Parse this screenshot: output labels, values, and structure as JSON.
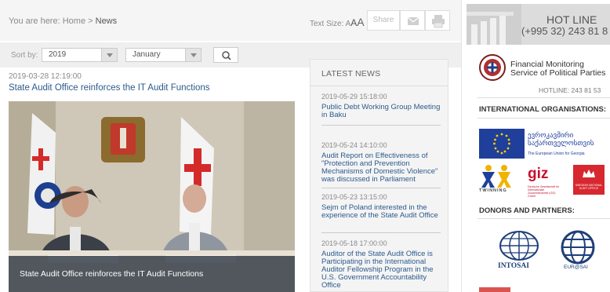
{
  "breadcrumb": {
    "prefix": "You are here:",
    "home": "Home",
    "separator": ">",
    "current": "News"
  },
  "text_size": {
    "label": "Text Size:",
    "small": "A",
    "medium": "A",
    "large": "A"
  },
  "toolbar": {
    "share_label": "Share",
    "mail_icon": "mail-icon",
    "print_icon": "print-icon"
  },
  "filter": {
    "sort_label": "Sort by:",
    "year_value": "2019",
    "month_value": "January",
    "search_icon": "search-icon"
  },
  "article": {
    "date": "2019-03-28 12:19:00",
    "title": "State Audit Office reinforces the IT Audit Functions",
    "caption": "State Audit Office reinforces the IT Audit Functions"
  },
  "latest_news": {
    "heading": "LATEST NEWS",
    "items": [
      {
        "date": "2019-05-29 15:18:00",
        "title": "Public Debt Working Group Meeting in Baku"
      },
      {
        "date": "2019-05-24 14:10:00",
        "title": "Audit Report on Effectiveness of \"Protection and Prevention Mechanisms of Domestic Violence\" was discussed in Parliament"
      },
      {
        "date": "2019-05-23 13:15:00",
        "title": "Sejm of Poland interested in the experience of the State Audit Office"
      },
      {
        "date": "2019-05-18 17:00:00",
        "title": "Auditor of the State Audit Office is Participating in the International Auditor Fellowship Program in the U.S. Government Accountability Office"
      }
    ]
  },
  "sidebar": {
    "hotline_title": "HOT LINE",
    "hotline_number": "(+995 32) 243 81 8",
    "fms_name_line1": "Financial Monitoring",
    "fms_name_line2": "Service of Political Parties",
    "fms_hotline": "HOTLINE: 243 81 53",
    "intl_heading": "INTERNATIONAL ORGANISATIONS:",
    "eu_text_line1": "ევროკავშირი",
    "eu_text_line2": "საქართველოსთვის",
    "eu_sub": "The European Union for Georgia",
    "twinning_label": "TWINNING",
    "giz_label": "giz",
    "giz_sub": "Deutsche Gesellschaft für Internationale Zusammenarbeit (GIZ) GmbH",
    "sao_sub": "SWEDISH NATIONAL AUDIT OFFICE",
    "donors_heading": "DONORS AND PARTNERS:",
    "intosai_label": "INTOSAI",
    "eurosai_label": "EUR@SAI"
  },
  "colors": {
    "link": "#2c5a8c",
    "eu_blue": "#1f3f9b",
    "giz_red": "#c8102e",
    "sao_red": "#d7282f"
  }
}
